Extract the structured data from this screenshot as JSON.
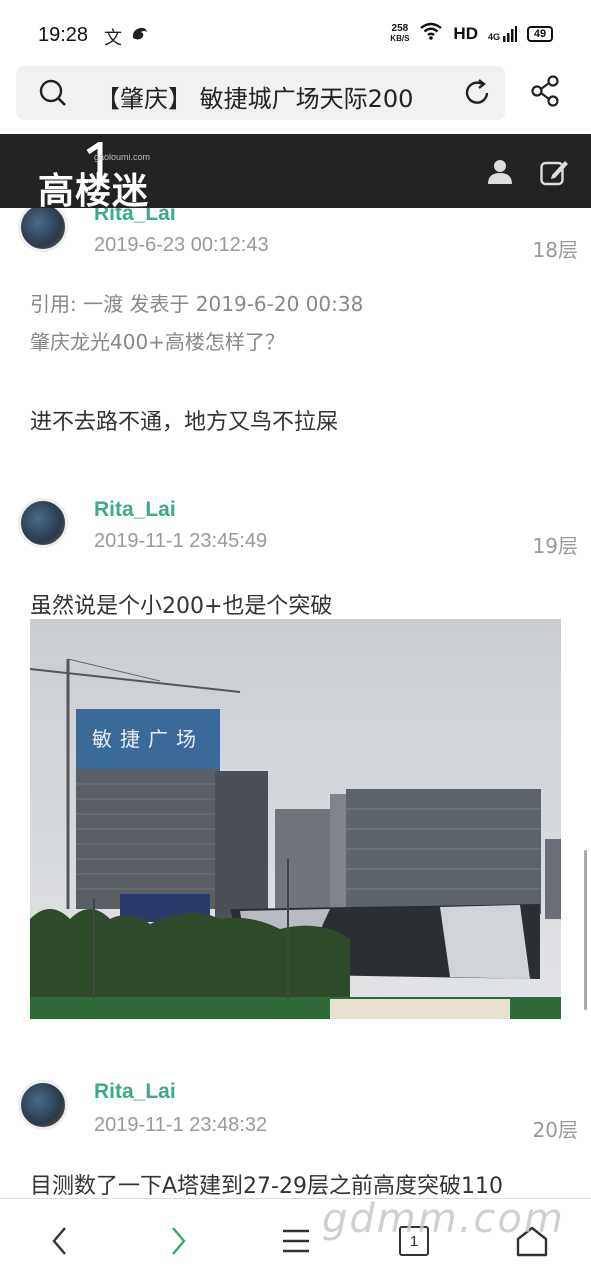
{
  "status": {
    "time": "19:28",
    "net_speed_value": "258",
    "net_speed_unit": "KB/S",
    "hd": "HD",
    "signal": "4G",
    "battery": "49"
  },
  "url_bar": {
    "title": "【肇庆】 敏捷城广场天际200"
  },
  "site": {
    "logo_text": "高楼迷",
    "logo_sub": "gaoloumi.com"
  },
  "posts": [
    {
      "username": "Rita_Lai",
      "timestamp": "2019-6-23 00:12:43",
      "floor": "18层",
      "quote_line1": "引用: 一渡 发表于 2019-6-20 00:38",
      "quote_line2": "肇庆龙光400+高楼怎样了？",
      "body": "进不去路不通，地方又鸟不拉屎"
    },
    {
      "username": "Rita_Lai",
      "timestamp": "2019-11-1 23:45:49",
      "floor": "19层",
      "body": "虽然说是个小200+也是个突破",
      "image_sign": "敏捷广场"
    },
    {
      "username": "Rita_Lai",
      "timestamp": "2019-11-1 23:48:32",
      "floor": "20层",
      "body": "目测数了一下A塔建到27-29层之前高度突破110"
    }
  ],
  "bottom_nav": {
    "tab_count": "1"
  },
  "watermark": "gdmm.com",
  "colors": {
    "username": "#3aaa8a",
    "header_bg": "#222222",
    "meta_gray": "#999999"
  }
}
